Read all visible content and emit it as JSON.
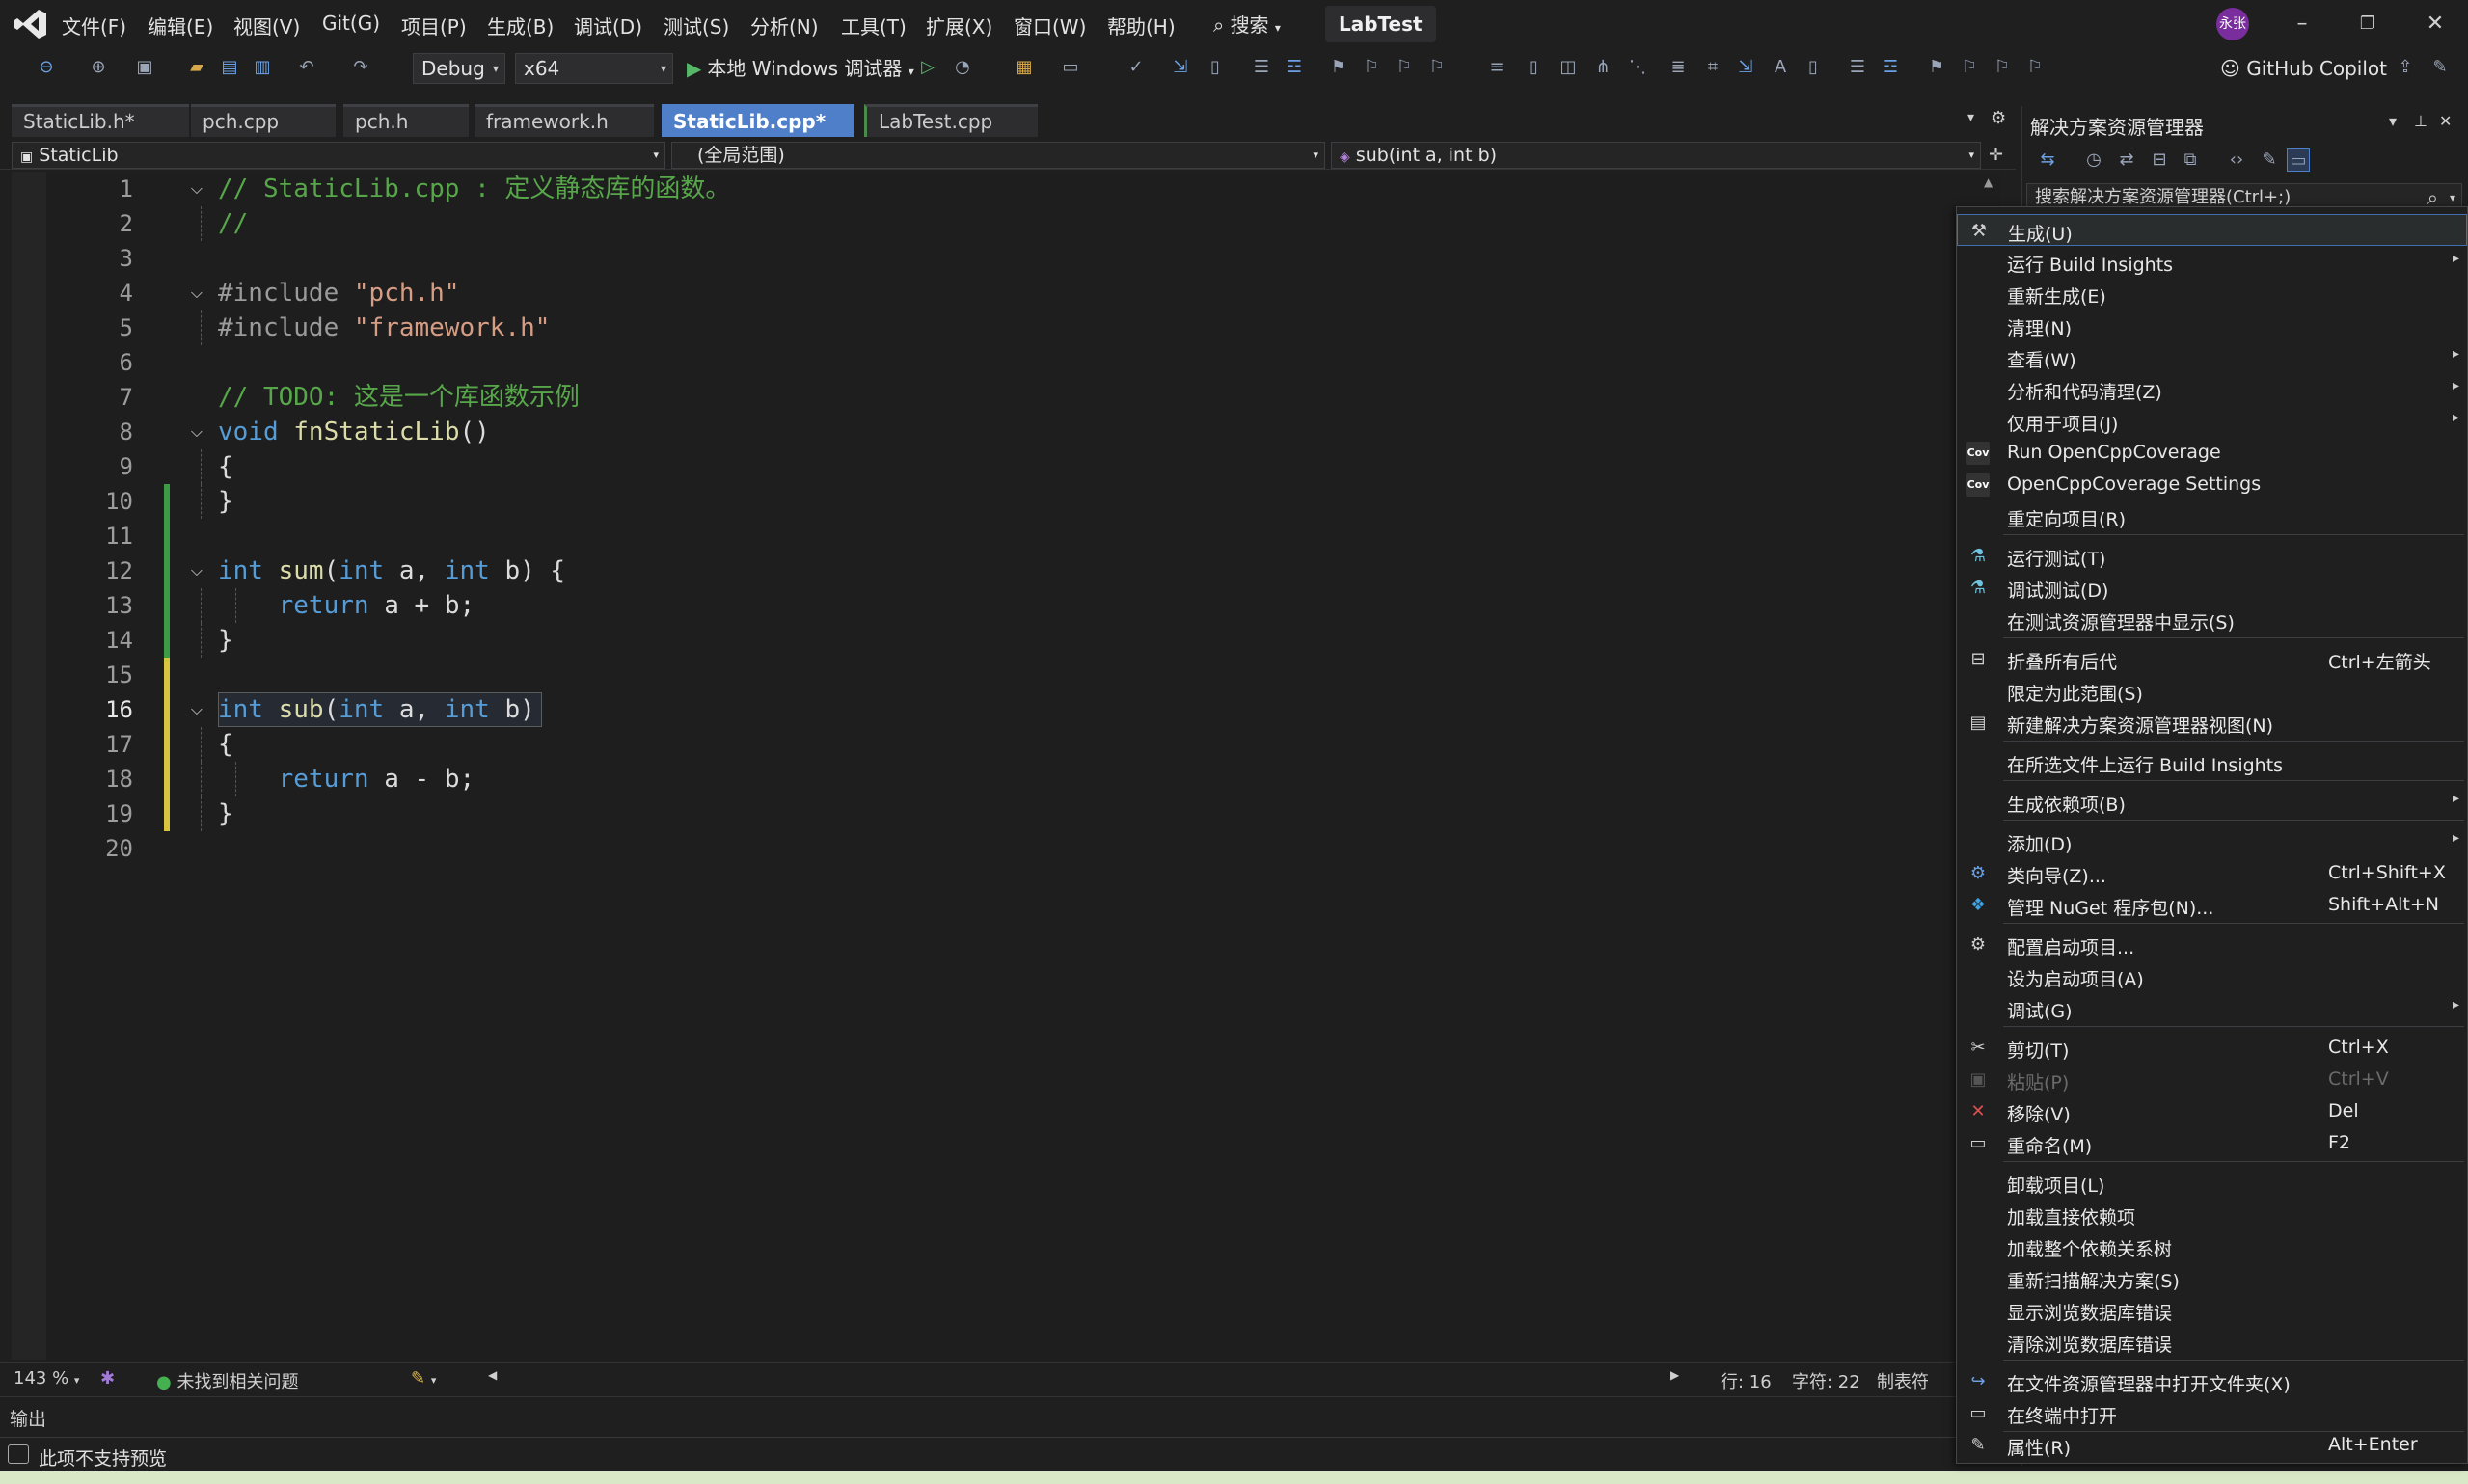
{
  "menubar": {
    "items": [
      "文件(F)",
      "编辑(E)",
      "视图(V)",
      "Git(G)",
      "项目(P)",
      "生成(B)",
      "调试(D)",
      "测试(S)",
      "分析(N)",
      "工具(T)",
      "扩展(X)",
      "窗口(W)",
      "帮助(H)"
    ],
    "search_label": "搜索",
    "solution_name": "LabTest",
    "avatar_text": "永张"
  },
  "toolbar": {
    "config": "Debug",
    "platform": "x64",
    "run_label": "本地 Windows 调试器",
    "copilot": "GitHub Copilot"
  },
  "tabs": [
    {
      "label": "StaticLib.h*"
    },
    {
      "label": "pch.cpp"
    },
    {
      "label": "pch.h"
    },
    {
      "label": "framework.h"
    },
    {
      "label": "StaticLib.cpp*",
      "active": true
    },
    {
      "label": "LabTest.cpp"
    }
  ],
  "navbar": {
    "project": "StaticLib",
    "scope": "(全局范围)",
    "member": "sub(int a, int b)"
  },
  "editor": {
    "current_line": 16,
    "lines": [
      "1",
      "2",
      "3",
      "4",
      "5",
      "6",
      "7",
      "8",
      "9",
      "10",
      "11",
      "12",
      "13",
      "14",
      "15",
      "16",
      "17",
      "18",
      "19",
      "20"
    ]
  },
  "edstatus": {
    "zoom": "143 %",
    "issues": "未找到相关问题",
    "position_line": "行: 16",
    "position_char": "字符: 22",
    "indent": "制表符"
  },
  "output": {
    "label": "输出"
  },
  "statusbar": {
    "message": "此项不支持预览"
  },
  "solution_explorer": {
    "title": "解决方案资源管理器",
    "search_placeholder": "搜索解决方案资源管理器(Ctrl+;)"
  },
  "context_menu": {
    "items": [
      {
        "label": "生成(U)",
        "shortcut": "",
        "icon": "build-icon"
      },
      {
        "label": "运行 Build Insights",
        "shortcut": "",
        "submenu": true
      },
      {
        "label": "重新生成(E)",
        "shortcut": ""
      },
      {
        "label": "清理(N)",
        "shortcut": ""
      },
      {
        "label": "查看(W)",
        "shortcut": "",
        "submenu": true
      },
      {
        "label": "分析和代码清理(Z)",
        "shortcut": "",
        "submenu": true
      },
      {
        "label": "仅用于项目(J)",
        "shortcut": "",
        "submenu": true
      },
      {
        "label": "Run OpenCppCoverage",
        "shortcut": "",
        "icon": "coverage-icon"
      },
      {
        "label": "OpenCppCoverage Settings",
        "shortcut": "",
        "icon": "coverage-settings-icon"
      },
      {
        "label": "重定向项目(R)",
        "shortcut": ""
      },
      {
        "label": "运行测试(T)",
        "shortcut": "",
        "icon": "run-tests-icon"
      },
      {
        "label": "调试测试(D)",
        "shortcut": "",
        "icon": "debug-tests-icon"
      },
      {
        "label": "在测试资源管理器中显示(S)",
        "shortcut": ""
      },
      {
        "label": "折叠所有后代",
        "shortcut": "Ctrl+左箭头",
        "icon": "collapse-icon"
      },
      {
        "label": "限定为此范围(S)",
        "shortcut": ""
      },
      {
        "label": "新建解决方案资源管理器视图(N)",
        "shortcut": "",
        "icon": "new-view-icon"
      },
      {
        "label": "在所选文件上运行 Build Insights",
        "shortcut": ""
      },
      {
        "label": "生成依赖项(B)",
        "shortcut": "",
        "submenu": true
      },
      {
        "label": "添加(D)",
        "shortcut": "",
        "submenu": true
      },
      {
        "label": "类向导(Z)...",
        "shortcut": "Ctrl+Shift+X",
        "icon": "class-wizard-icon"
      },
      {
        "label": "管理 NuGet 程序包(N)...",
        "shortcut": "Shift+Alt+N",
        "icon": "nuget-icon"
      },
      {
        "label": "配置启动项目...",
        "shortcut": "",
        "icon": "gear-icon"
      },
      {
        "label": "设为启动项目(A)",
        "shortcut": ""
      },
      {
        "label": "调试(G)",
        "shortcut": "",
        "submenu": true
      },
      {
        "label": "剪切(T)",
        "shortcut": "Ctrl+X",
        "icon": "scissors-icon"
      },
      {
        "label": "粘贴(P)",
        "shortcut": "Ctrl+V",
        "icon": "paste-icon",
        "disabled": true
      },
      {
        "label": "移除(V)",
        "shortcut": "Del",
        "icon": "remove-icon"
      },
      {
        "label": "重命名(M)",
        "shortcut": "F2",
        "icon": "rename-icon"
      },
      {
        "label": "卸载项目(L)",
        "shortcut": ""
      },
      {
        "label": "加载直接依赖项",
        "shortcut": ""
      },
      {
        "label": "加载整个依赖关系树",
        "shortcut": ""
      },
      {
        "label": "重新扫描解决方案(S)",
        "shortcut": ""
      },
      {
        "label": "显示浏览数据库错误",
        "shortcut": ""
      },
      {
        "label": "清除浏览数据库错误",
        "shortcut": ""
      },
      {
        "label": "在文件资源管理器中打开文件夹(X)",
        "shortcut": "",
        "icon": "open-folder-icon"
      },
      {
        "label": "在终端中打开",
        "shortcut": "",
        "icon": "terminal-icon"
      },
      {
        "label": "属性(R)",
        "shortcut": "Alt+Enter",
        "icon": "wrench-icon"
      }
    ]
  },
  "colors": {
    "active_tab": "#4f7fc9",
    "keyword": "#569cd6",
    "comment": "#57a64a",
    "string": "#d69d85",
    "function": "#dcdcaa",
    "change_saved": "#3c9c46",
    "change_unsaved": "#d8c53f"
  }
}
